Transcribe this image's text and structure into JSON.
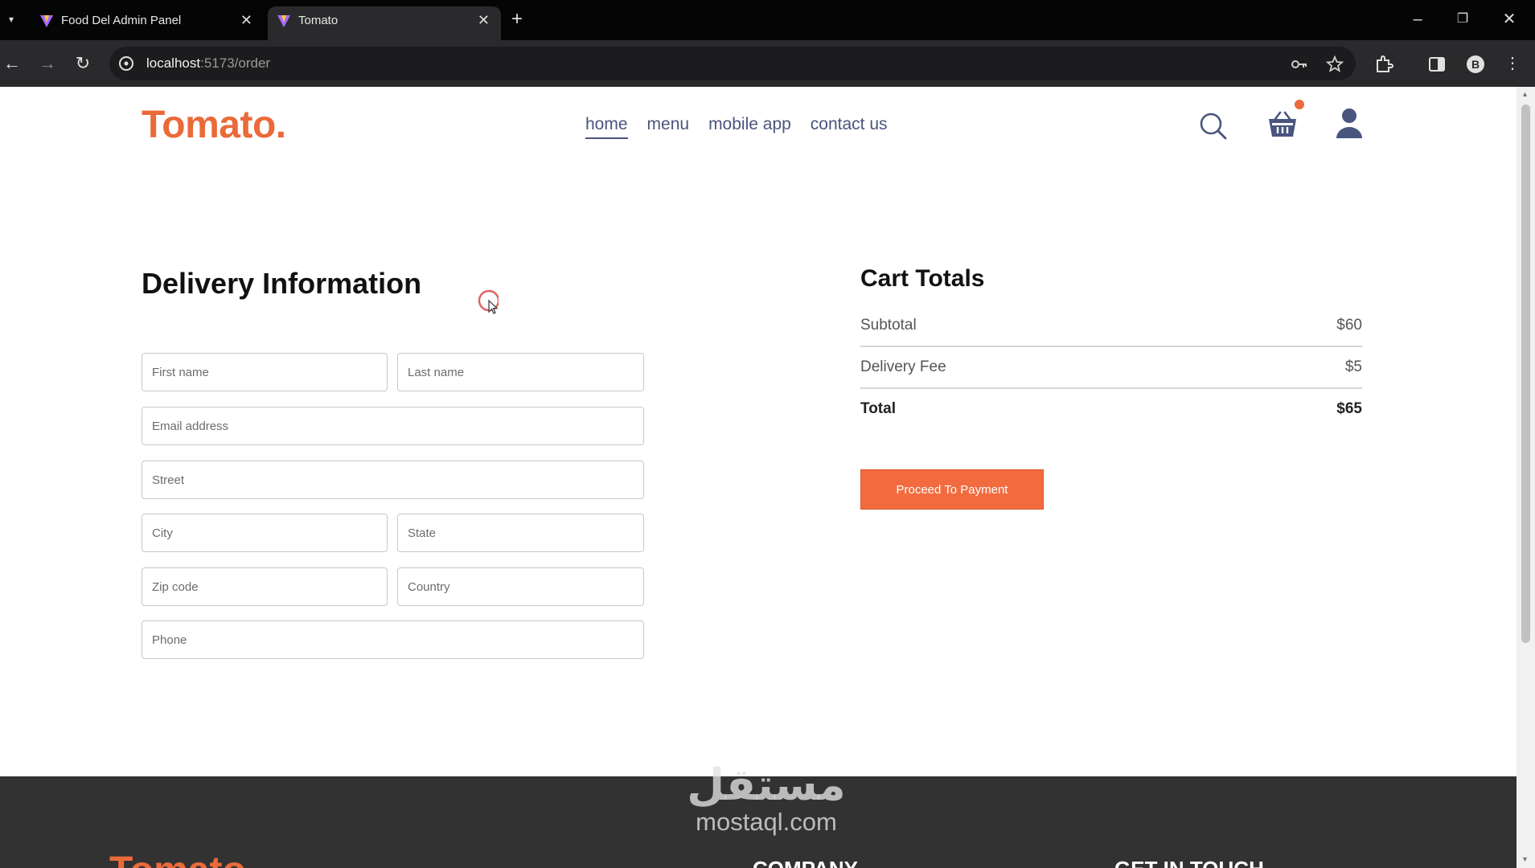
{
  "browser": {
    "tabs": [
      {
        "title": "Food Del Admin Panel",
        "active": false
      },
      {
        "title": "Tomato",
        "active": true
      }
    ],
    "url_host": "localhost",
    "url_path": ":5173/order"
  },
  "site": {
    "logo": "Tomato.",
    "nav": [
      {
        "label": "home",
        "active": true
      },
      {
        "label": "menu",
        "active": false
      },
      {
        "label": "mobile app",
        "active": false
      },
      {
        "label": "contact us",
        "active": false
      }
    ],
    "icons": [
      "search-icon",
      "basket-icon",
      "profile-icon"
    ],
    "accent": "#ea6a3a"
  },
  "delivery": {
    "title": "Delivery Information",
    "fields": {
      "first_name": "First name",
      "last_name": "Last name",
      "email": "Email address",
      "street": "Street",
      "city": "City",
      "state": "State",
      "zip": "Zip code",
      "country": "Country",
      "phone": "Phone"
    }
  },
  "cart": {
    "title": "Cart Totals",
    "subtotal_label": "Subtotal",
    "subtotal_value": "$60",
    "fee_label": "Delivery Fee",
    "fee_value": "$5",
    "total_label": "Total",
    "total_value": "$65",
    "button": "Proceed To Payment"
  },
  "footer": {
    "logo": "Tomato.",
    "headings": [
      "COMPANY",
      "GET IN TOUCH"
    ]
  },
  "watermark": {
    "arabic": "مستقل",
    "latin": "mostaql.com"
  }
}
